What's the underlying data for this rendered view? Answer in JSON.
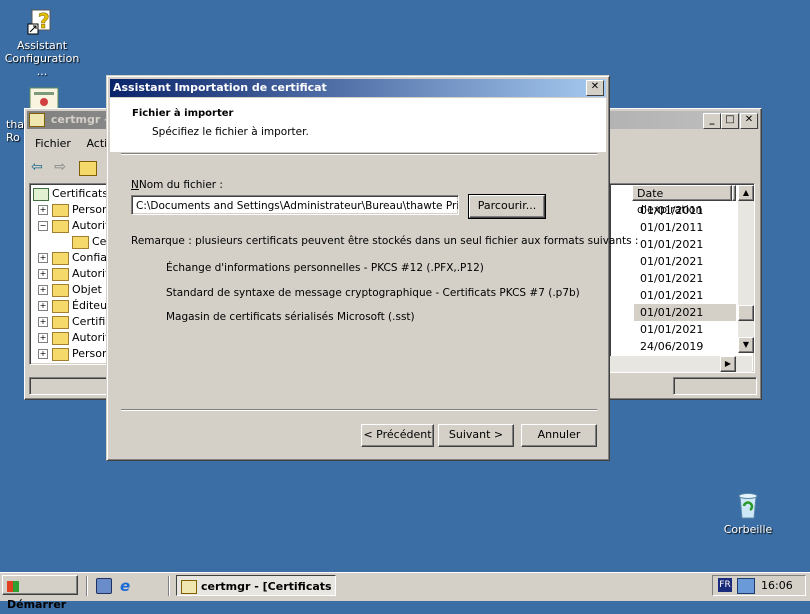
{
  "desktop": {
    "icons": [
      {
        "label": "Assistant Configuration ..."
      },
      {
        "label": "tha Ro"
      },
      {
        "label": "Corbeille"
      }
    ]
  },
  "certmgr": {
    "title": "certmgr - [",
    "menu": [
      "Fichier",
      "Actio"
    ],
    "tree": [
      "Certificats",
      "Personn",
      "Autorité",
      "Cer",
      "Confian",
      "Autorité",
      "Objet u",
      "Éditeur",
      "Certific",
      "Autorité",
      "Personn"
    ],
    "column_header": "Date d'expiration",
    "dates": [
      "01/01/2011",
      "01/01/2011",
      "01/01/2021",
      "01/01/2021",
      "01/01/2021",
      "01/01/2021",
      "01/01/2021",
      "01/01/2021",
      "24/06/2019"
    ]
  },
  "dialog": {
    "title": "Assistant Importation de certificat",
    "heading": "Fichier à importer",
    "subheading": "Spécifiez le fichier à importer.",
    "filename_label": "Nom du fichier :",
    "filename_value": "C:\\Documents and Settings\\Administrateur\\Bureau\\thawte Primary",
    "browse_label": "Parcourir...",
    "note": "Remarque : plusieurs certificats peuvent être stockés dans un seul fichier aux formats suivants :",
    "formats": [
      "Échange d'informations personnelles - PKCS #12 (.PFX,.P12)",
      "Standard de syntaxe de message cryptographique - Certificats PKCS #7 (.p7b)",
      "Magasin de certificats sérialisés Microsoft (.sst)"
    ],
    "back_label": "< Précédent",
    "next_label": "Suivant >",
    "cancel_label": "Annuler"
  },
  "taskbar": {
    "start_label": "Démarrer",
    "task_label": "certmgr - [Certificats ...",
    "lang": "FR",
    "clock": "16:06"
  },
  "colors": {
    "desktop": "#3a6ea5",
    "title_active": "#0a246a",
    "title_inactive": "#808080",
    "face": "#d4d0c8"
  }
}
